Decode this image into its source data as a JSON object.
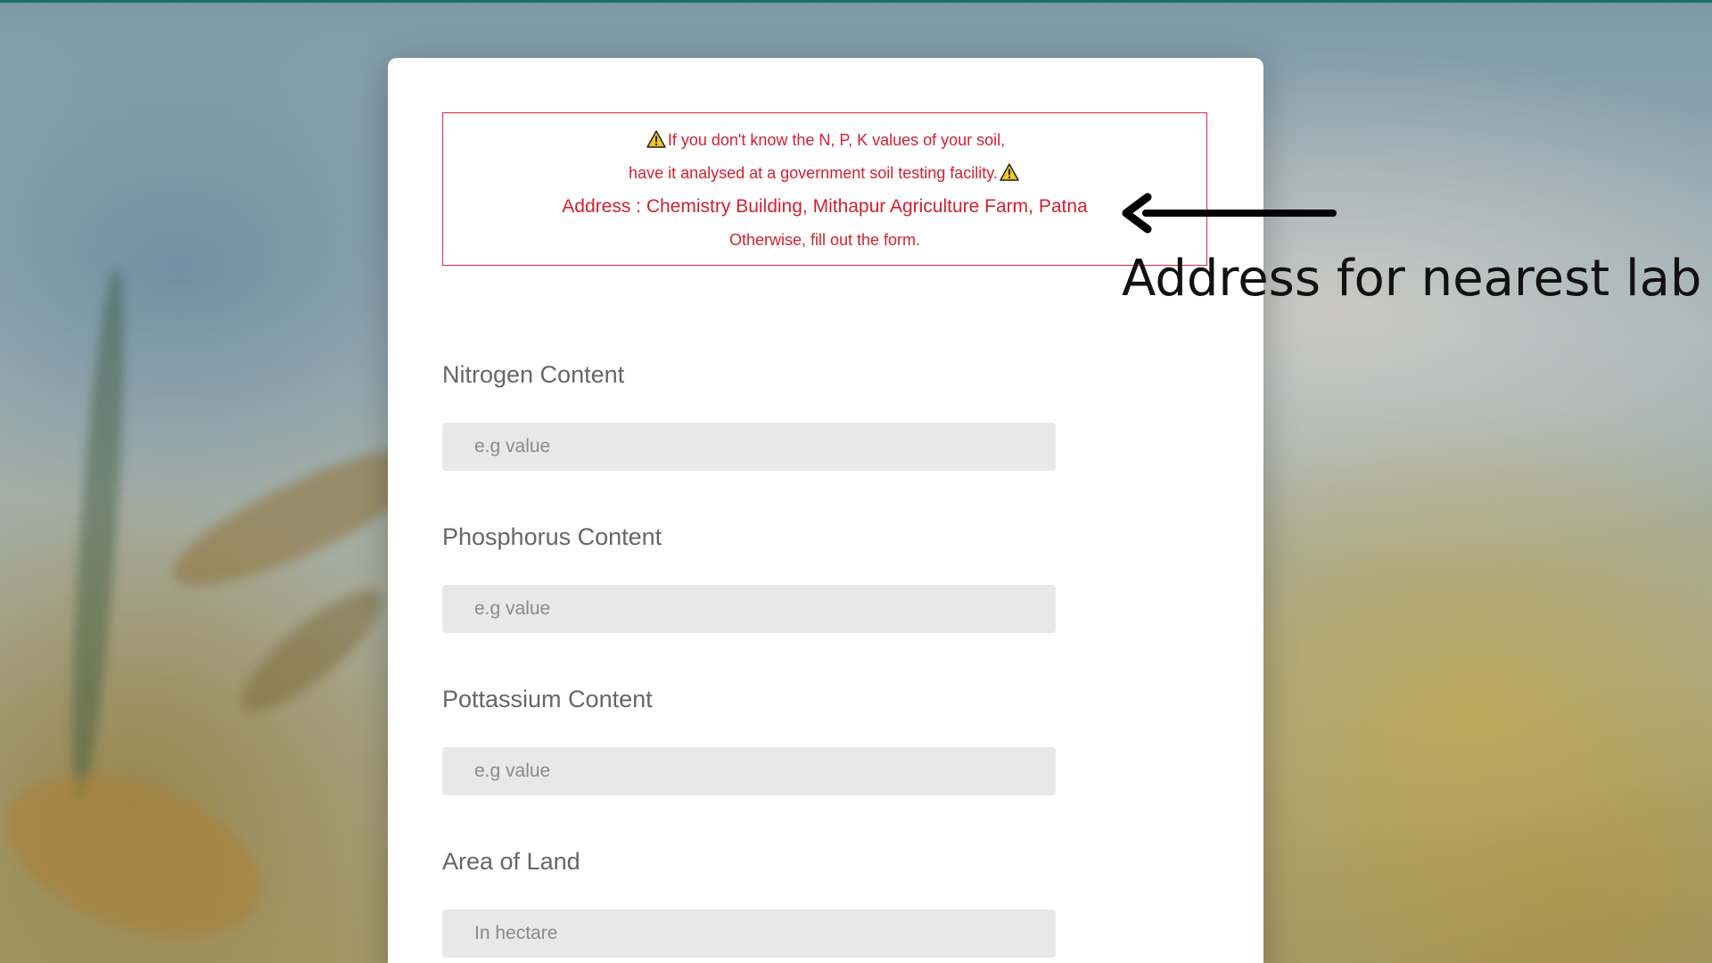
{
  "notice": {
    "line1": "If you don't know the N, P, K values of your soil,",
    "line2": "have it analysed at a government soil testing facility.",
    "address": "Address : Chemistry Building, Mithapur Agriculture Farm, Patna",
    "line4": "Otherwise, fill out the form.",
    "warning_icon": "warning-triangle-icon",
    "color": "#d4202f"
  },
  "form": {
    "fields": [
      {
        "label": "Nitrogen Content",
        "placeholder": "e.g value",
        "value": ""
      },
      {
        "label": "Phosphorus Content",
        "placeholder": "e.g value",
        "value": ""
      },
      {
        "label": "Pottassium Content",
        "placeholder": "e.g value",
        "value": ""
      },
      {
        "label": "Area of Land",
        "placeholder": "In hectare",
        "value": ""
      }
    ]
  },
  "annotation": {
    "text": "Address for nearest lab",
    "arrow_icon": "left-arrow-icon"
  },
  "colors": {
    "accent_bar": "#1f6f6a",
    "input_bg": "#e8e8e8",
    "label": "#666666"
  }
}
